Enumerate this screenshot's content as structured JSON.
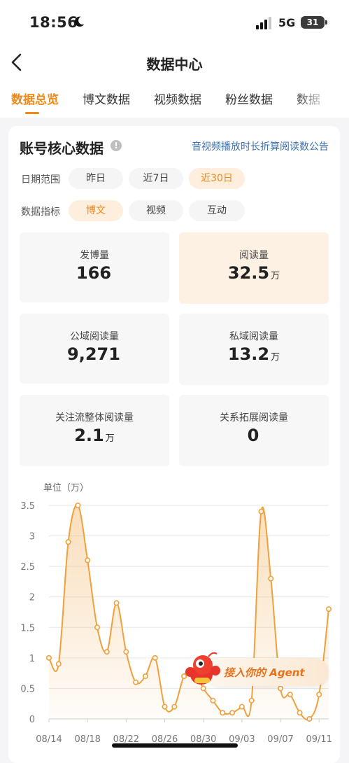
{
  "status_bar": {
    "time": "18:56",
    "network": "5G",
    "battery": "31"
  },
  "nav": {
    "title": "数据中心"
  },
  "tabs": [
    {
      "label": "数据总览",
      "active": true
    },
    {
      "label": "博文数据"
    },
    {
      "label": "视频数据"
    },
    {
      "label": "粉丝数据"
    },
    {
      "label": "数据"
    }
  ],
  "card": {
    "title": "账号核心数据",
    "notice": "音视频播放时长折算阅读数公告",
    "date_range_label": "日期范围",
    "date_options": [
      "昨日",
      "近7日",
      "近30日"
    ],
    "date_selected": "近30日",
    "metric_type_label": "数据指标",
    "metric_options": [
      "博文",
      "视频",
      "互动"
    ],
    "metric_selected": "博文",
    "metrics": [
      {
        "label": "发博量",
        "value": "166",
        "unit": ""
      },
      {
        "label": "阅读量",
        "value": "32.5",
        "unit": "万"
      },
      {
        "label": "公域阅读量",
        "value": "9,271",
        "unit": ""
      },
      {
        "label": "私域阅读量",
        "value": "13.2",
        "unit": "万"
      },
      {
        "label": "关注流整体阅读量",
        "value": "2.1",
        "unit": "万"
      },
      {
        "label": "关系拓展阅读量",
        "value": "0",
        "unit": ""
      }
    ]
  },
  "chart_data": {
    "type": "area",
    "unit_label": "单位（万）",
    "ylim": [
      0,
      3.5
    ],
    "yticks": [
      "0",
      "0.5",
      "1",
      "1.5",
      "2",
      "2.5",
      "3",
      "3.5"
    ],
    "xticks": [
      "08/14",
      "08/18",
      "08/22",
      "08/26",
      "08/30",
      "09/03",
      "09/07",
      "09/11"
    ],
    "x": [
      "08/14",
      "08/15",
      "08/16",
      "08/17",
      "08/18",
      "08/19",
      "08/20",
      "08/21",
      "08/22",
      "08/23",
      "08/24",
      "08/25",
      "08/26",
      "08/27",
      "08/28",
      "08/29",
      "08/30",
      "08/31",
      "09/01",
      "09/02",
      "09/03",
      "09/04",
      "09/05",
      "09/06",
      "09/07",
      "09/08",
      "09/09",
      "09/10",
      "09/11",
      "09/12"
    ],
    "values": [
      1.0,
      0.9,
      2.9,
      3.5,
      2.6,
      1.5,
      1.1,
      1.9,
      1.1,
      0.6,
      0.7,
      1.0,
      0.2,
      0.2,
      0.7,
      0.8,
      0.5,
      0.3,
      0.1,
      0.1,
      0.2,
      0.3,
      3.4,
      2.3,
      0.5,
      0.4,
      0.1,
      0.0,
      0.4,
      1.8
    ],
    "color": "#f0a03c",
    "grid": true
  },
  "agent_button": {
    "label": "接入你的 Agent"
  },
  "colors": {
    "accent": "#ee8a19",
    "link": "#3a6fb0",
    "line": "#f0a03c"
  }
}
